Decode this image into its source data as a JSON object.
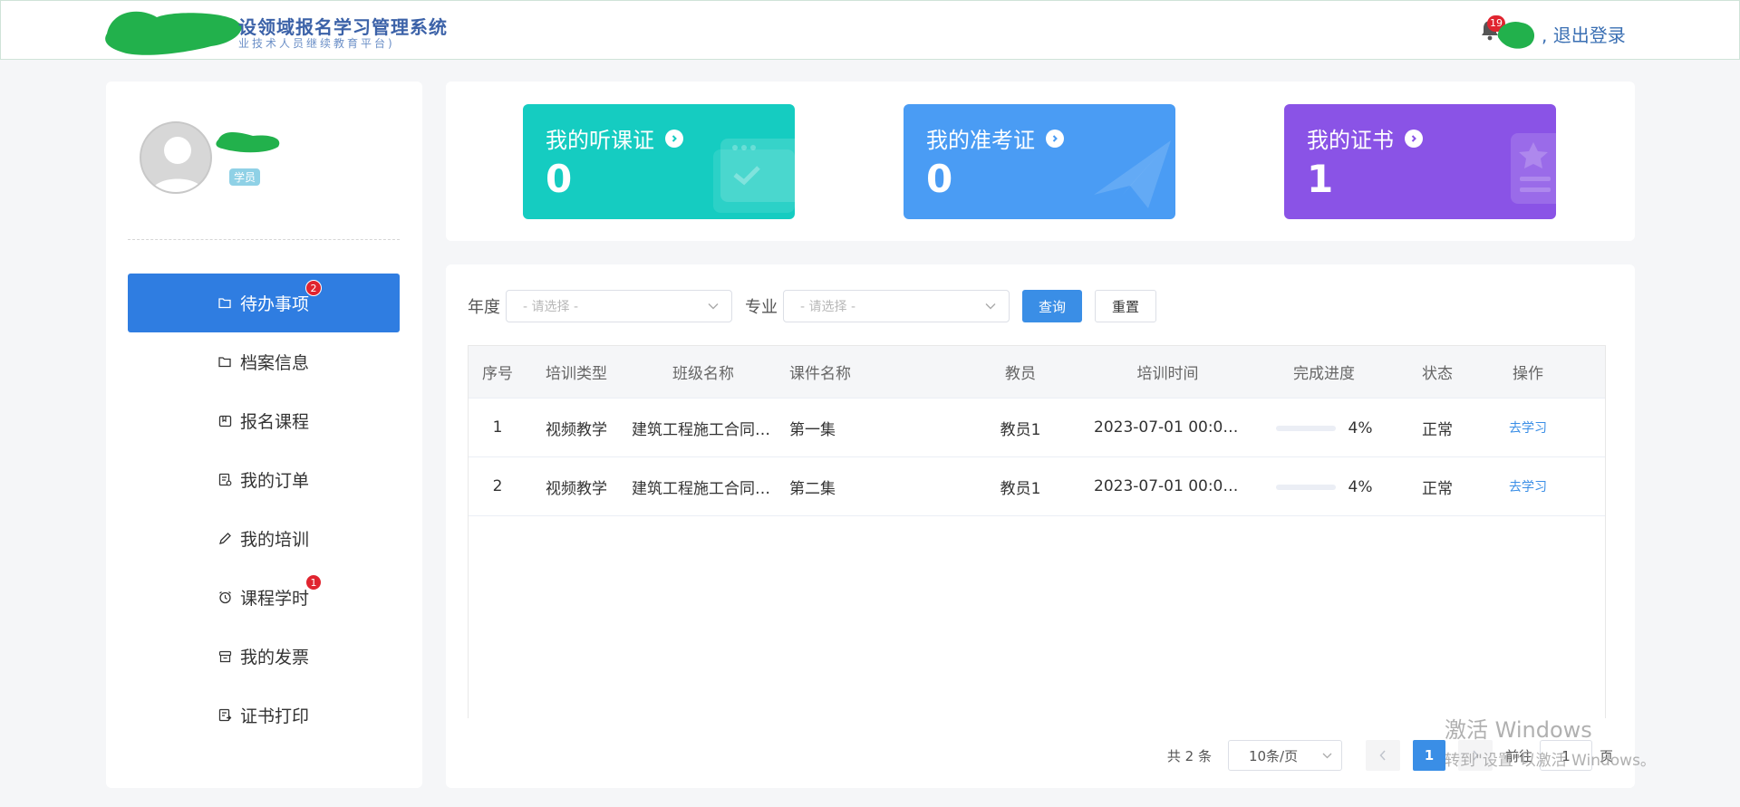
{
  "header": {
    "title": "设领域报名学习管理系统",
    "subtitle": "业技术人员继续教育平台)",
    "notifications_count": "19",
    "logout_separator": ",",
    "logout_label": "退出登录"
  },
  "sidebar": {
    "role": "学员",
    "items": [
      {
        "label": "待办事项",
        "icon": "folder-open-icon",
        "badge": "2",
        "active": true
      },
      {
        "label": "档案信息",
        "icon": "folder-icon",
        "badge": null,
        "active": false
      },
      {
        "label": "报名课程",
        "icon": "book-icon",
        "badge": null,
        "active": false
      },
      {
        "label": "我的订单",
        "icon": "order-icon",
        "badge": null,
        "active": false
      },
      {
        "label": "我的培训",
        "icon": "pencil-icon",
        "badge": null,
        "active": false
      },
      {
        "label": "课程学时",
        "icon": "alarm-clock-icon",
        "badge": "1",
        "active": false
      },
      {
        "label": "我的发票",
        "icon": "invoice-icon",
        "badge": null,
        "active": false
      },
      {
        "label": "证书打印",
        "icon": "print-icon",
        "badge": null,
        "active": false
      }
    ]
  },
  "cards": [
    {
      "title": "我的听课证",
      "value": "0",
      "color": "#15ccc1"
    },
    {
      "title": "我的准考证",
      "value": "0",
      "color": "#4a9cf4"
    },
    {
      "title": "我的证书",
      "value": "1",
      "color": "#8a53e6"
    }
  ],
  "filters": {
    "year_label": "年度",
    "year_placeholder": "- 请选择 -",
    "major_label": "专业",
    "major_placeholder": "- 请选择 -",
    "query_label": "查询",
    "reset_label": "重置"
  },
  "table": {
    "columns": [
      "序号",
      "培训类型",
      "班级名称",
      "课件名称",
      "教员",
      "培训时间",
      "完成进度",
      "状态",
      "操作"
    ],
    "rows": [
      {
        "no": "1",
        "type": "视频教学",
        "class_name": "建筑工程施工合同法...",
        "courseware": "第一集",
        "teacher": "教员1",
        "time": "2023-07-01 00:00...",
        "progress": 4,
        "progress_text": "4%",
        "status": "正常",
        "action": "去学习"
      },
      {
        "no": "2",
        "type": "视频教学",
        "class_name": "建筑工程施工合同法...",
        "courseware": "第二集",
        "teacher": "教员1",
        "time": "2023-07-01 00:00...",
        "progress": 4,
        "progress_text": "4%",
        "status": "正常",
        "action": "去学习"
      }
    ]
  },
  "pagination": {
    "total_text": "共 2 条",
    "page_size": "10条/页",
    "current_page": "1",
    "goto_label": "前往",
    "goto_value": "1",
    "page_suffix": "页"
  },
  "watermark": {
    "line1": "激活 Windows",
    "line2": "转到\"设置\"以激活 Windows。"
  }
}
